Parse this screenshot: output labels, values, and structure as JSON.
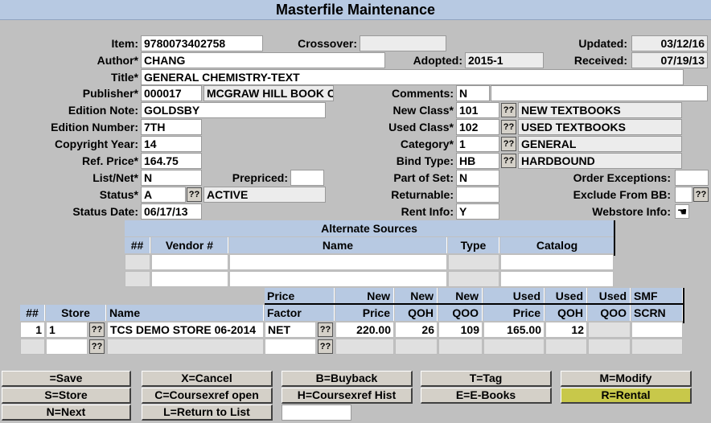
{
  "title": "Masterfile Maintenance",
  "labels": {
    "item": "Item:",
    "author": "Author*",
    "title": "Title*",
    "publisher": "Publisher*",
    "edition_note": "Edition Note:",
    "edition_number": "Edition Number:",
    "copyright_year": "Copyright Year:",
    "ref_price": "Ref. Price*",
    "list_net": "List/Net*",
    "status": "Status*",
    "status_date": "Status Date:",
    "crossover": "Crossover:",
    "adopted": "Adopted:",
    "prepriced": "Prepriced:",
    "comments": "Comments:",
    "new_class": "New Class*",
    "used_class": "Used Class*",
    "category": "Category*",
    "bind_type": "Bind Type:",
    "part_of_set": "Part of Set:",
    "returnable": "Returnable:",
    "rent_info": "Rent Info:",
    "updated": "Updated:",
    "received": "Received:",
    "order_exceptions": "Order Exceptions:",
    "exclude_from_bb": "Exclude From BB:",
    "webstore_info": "Webstore Info:"
  },
  "values": {
    "item": "9780073402758",
    "author": "CHANG",
    "title": "GENERAL CHEMISTRY-TEXT",
    "publisher_code": "000017",
    "publisher_name": "MCGRAW HILL BOOK C",
    "edition_note": "GOLDSBY",
    "edition_number": "7TH",
    "copyright_year": "14",
    "ref_price": "164.75",
    "list_net": "N",
    "status_code": "A",
    "status_desc": "ACTIVE",
    "status_date": "06/17/13",
    "crossover": "",
    "adopted": "2015-1",
    "prepriced": "",
    "comments_flag": "N",
    "comments_text": "",
    "new_class_code": "101",
    "new_class_desc": "NEW TEXTBOOKS",
    "used_class_code": "102",
    "used_class_desc": "USED TEXTBOOKS",
    "category_code": "1",
    "category_desc": "GENERAL",
    "bind_type_code": "HB",
    "bind_type_desc": "HARDBOUND",
    "part_of_set": "N",
    "returnable": "",
    "rent_info": "Y",
    "updated": "03/12/16",
    "received": "07/19/13",
    "order_exceptions": "",
    "exclude_from_bb": ""
  },
  "lookup_label": "??",
  "alternate_sources": {
    "title": "Alternate Sources",
    "headers": [
      "##",
      "Vendor #",
      "Name",
      "Type",
      "Catalog"
    ]
  },
  "store_grid": {
    "headers_top": [
      "Price",
      "New",
      "New",
      "New",
      "Used",
      "Used",
      "Used",
      "SMF"
    ],
    "headers": [
      "##",
      "Store",
      "Name",
      "Factor",
      "Price",
      "QOH",
      "QOO",
      "Price",
      "QOH",
      "QOO",
      "SCRN"
    ],
    "rows": [
      {
        "num": "1",
        "store": "1",
        "name": "TCS DEMO STORE 06-2014",
        "factor": "NET",
        "new_price": "220.00",
        "new_qoh": "26",
        "new_qoo": "109",
        "used_price": "165.00",
        "used_qoh": "12",
        "used_qoo": "",
        "smf": ""
      }
    ]
  },
  "buttons": {
    "save": "=Save",
    "cancel": "X=Cancel",
    "buyback": "B=Buyback",
    "tag": "T=Tag",
    "modify": "M=Modify",
    "store": "S=Store",
    "coursexref_open": "C=Coursexref open",
    "coursexref_hist": "H=Coursexref Hist",
    "ebooks": "E=E-Books",
    "rental": "R=Rental",
    "next": "N=Next",
    "return_list": "L=Return to List"
  },
  "colors": {
    "header_bg": "#b7c9e2",
    "background": "#c0c0c0",
    "rental_btn": "#c8c84a"
  }
}
